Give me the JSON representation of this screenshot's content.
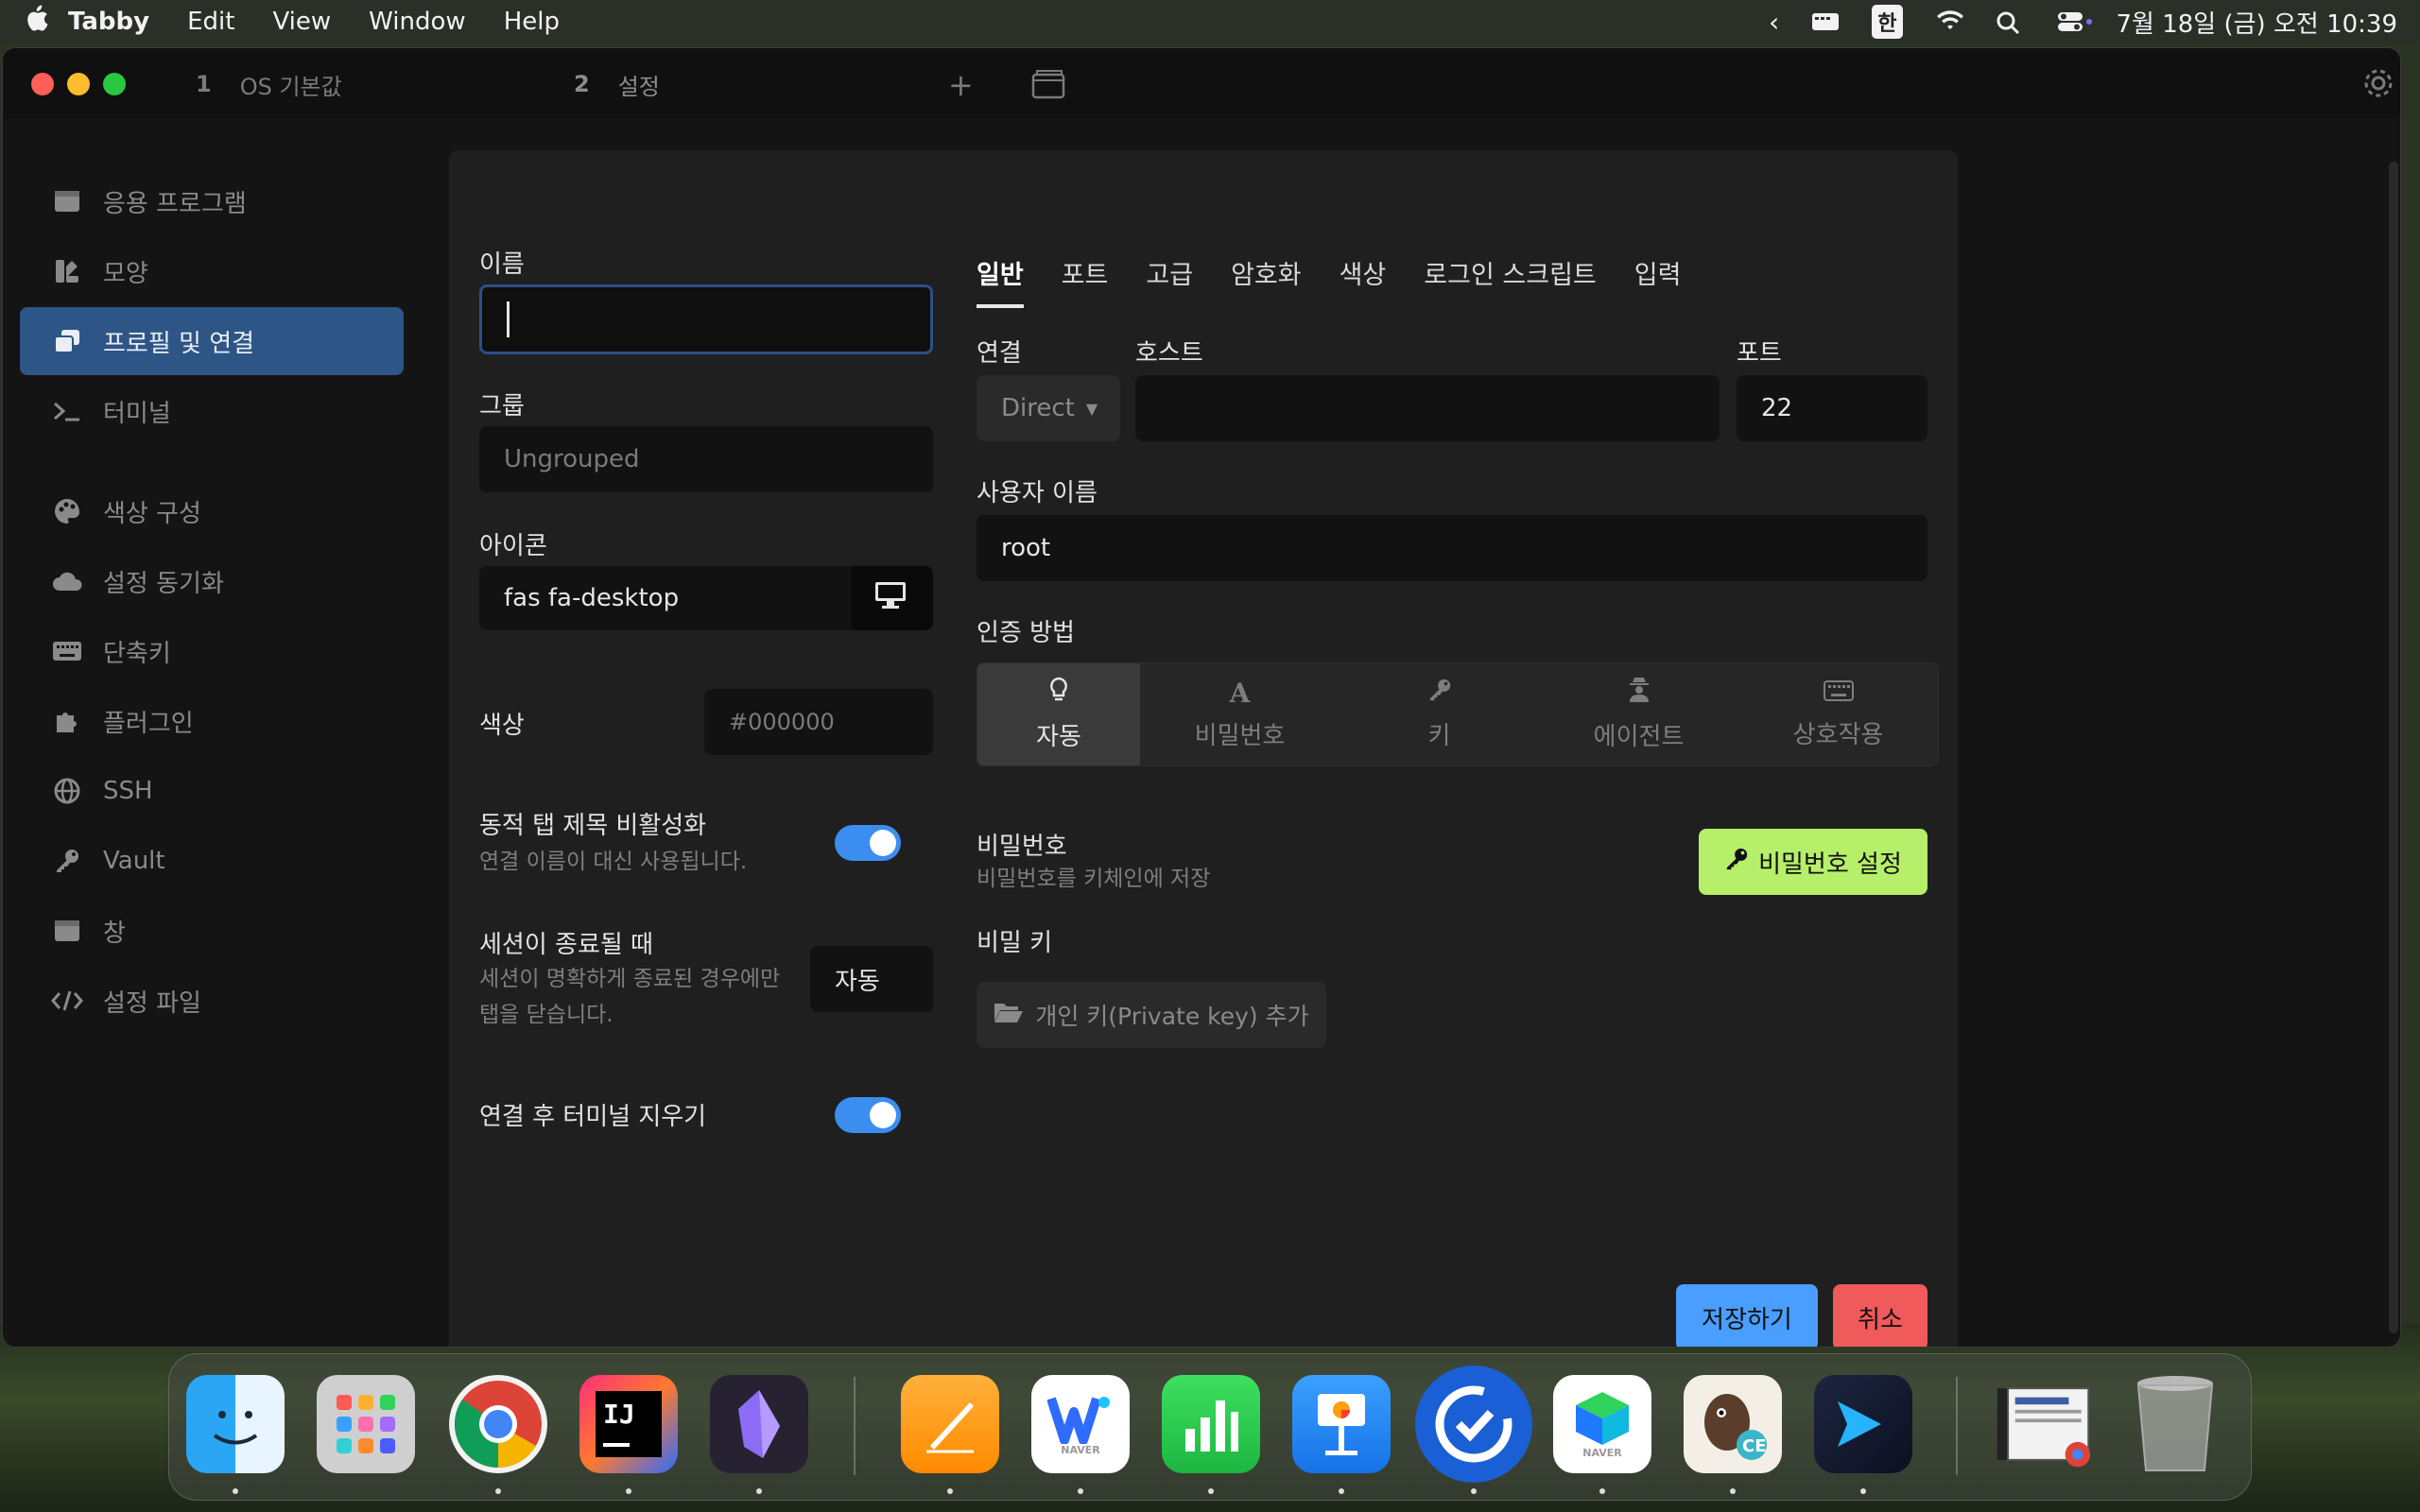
{
  "menubar": {
    "app_name": "Tabby",
    "menus": [
      "Edit",
      "View",
      "Window",
      "Help"
    ],
    "ime": "한",
    "clock": "7월 18일 (금) 오전 10:39"
  },
  "window": {
    "tabs": [
      {
        "num": "1",
        "label": "OS 기본값"
      },
      {
        "num": "2",
        "label": "설정"
      }
    ]
  },
  "sidebar": {
    "items": [
      {
        "label": "응용 프로그램",
        "icon": "window-icon"
      },
      {
        "label": "모양",
        "icon": "palette-brush-icon"
      },
      {
        "label": "프로필 및 연결",
        "icon": "windows-stack-icon"
      },
      {
        "label": "터미널",
        "icon": "terminal-prompt-icon"
      },
      {
        "label": "색상 구성",
        "icon": "palette-icon"
      },
      {
        "label": "설정 동기화",
        "icon": "cloud-icon"
      },
      {
        "label": "단축키",
        "icon": "keyboard-icon"
      },
      {
        "label": "플러그인",
        "icon": "puzzle-icon"
      },
      {
        "label": "SSH",
        "icon": "globe-icon"
      },
      {
        "label": "Vault",
        "icon": "key-icon"
      },
      {
        "label": "창",
        "icon": "window-icon"
      },
      {
        "label": "설정 파일",
        "icon": "code-icon"
      }
    ]
  },
  "profile": {
    "name_label": "이름",
    "name_value": "",
    "group_label": "그룹",
    "group_placeholder": "Ungrouped",
    "icon_label": "아이콘",
    "icon_value": "fas fa-desktop",
    "color_label": "색상",
    "color_placeholder": "#000000",
    "dynamic_title_label": "동적 탭 제목 비활성화",
    "dynamic_title_sub": "연결 이름이 대신 사용됩니다.",
    "session_end_label": "세션이 종료될 때",
    "session_end_sub1": "세션이 명확하게 종료된 경우에만",
    "session_end_sub2": "탭을 닫습니다.",
    "session_end_value": "자동",
    "clear_terminal_label": "연결 후 터미널 지우기"
  },
  "tabs": [
    "일반",
    "포트",
    "고급",
    "암호화",
    "색상",
    "로그인 스크립트",
    "입력"
  ],
  "connection": {
    "conn_label": "연결",
    "conn_value": "Direct",
    "host_label": "호스트",
    "host_value": "",
    "port_label": "포트",
    "port_value": "22",
    "user_label": "사용자 이름",
    "user_value": "root",
    "auth_label": "인증 방법",
    "auth_options": [
      {
        "label": "자동",
        "icon": "lightbulb-icon"
      },
      {
        "label": "비밀번호",
        "icon": "font-a-icon"
      },
      {
        "label": "키",
        "icon": "key-icon"
      },
      {
        "label": "에이전트",
        "icon": "user-secret-icon"
      },
      {
        "label": "상호작용",
        "icon": "keyboard-icon"
      }
    ],
    "password_label": "비밀번호",
    "password_sub": "비밀번호를 키체인에 저장",
    "password_button": "비밀번호 설정",
    "private_key_label": "비밀 키",
    "private_key_button": "개인 키(Private key) 추가"
  },
  "actions": {
    "save": "저장하기",
    "cancel": "취소"
  },
  "colors": {
    "accent_blue": "#4a9eff",
    "active_sidebar": "#2d5586",
    "password_button": "#b6f06a",
    "cancel_red": "#f05a5a"
  },
  "dock": {
    "apps": [
      "Finder",
      "Launchpad",
      "Chrome",
      "IntelliJ IDEA",
      "Obsidian",
      "Pages",
      "Naver Whale",
      "Numbers",
      "Keynote",
      "Sync",
      "Naver Box",
      "DBeaver",
      "Tabby",
      "Preview",
      "Trash"
    ]
  }
}
